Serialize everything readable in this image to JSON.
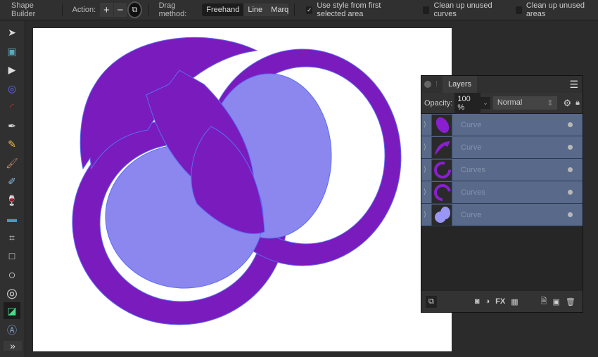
{
  "context_toolbar": {
    "tool_name": "Shape Builder",
    "action_label": "Action:",
    "actions": [
      "+",
      "−",
      "intersect"
    ],
    "drag_method_label": "Drag method:",
    "drag_methods": [
      "Freehand",
      "Line",
      "Marquee"
    ],
    "selected_drag_method": "Freehand",
    "options": [
      {
        "label": "Use style from first selected area",
        "checked": true
      },
      {
        "label": "Clean up unused curves",
        "checked": false
      },
      {
        "label": "Clean up unused areas",
        "checked": false
      }
    ]
  },
  "tools": [
    "move-tool",
    "artboard-tool",
    "node-tool",
    "point-transform-tool",
    "corner-tool",
    "pen-tool",
    "pencil-tool",
    "vector-brush-tool",
    "fill-tool",
    "transparency-tool",
    "place-image-tool",
    "crop-tool",
    "rectangle-tool",
    "ellipse-tool",
    "donut-tool",
    "shape-builder-tool",
    "frame-text-tool",
    "more-tools"
  ],
  "layers": {
    "tab": "Layers",
    "opacity_label": "Opacity:",
    "opacity": "100 %",
    "blend_mode": "Normal",
    "rows": [
      {
        "name": "Curve"
      },
      {
        "name": "Curve"
      },
      {
        "name": "Curves"
      },
      {
        "name": "Curves"
      },
      {
        "name": "Curve"
      }
    ]
  },
  "colors": {
    "purple": "#7a1bbd",
    "lavender": "#8b87ef",
    "outline": "#5b6cf2",
    "selection": "#58698a"
  }
}
